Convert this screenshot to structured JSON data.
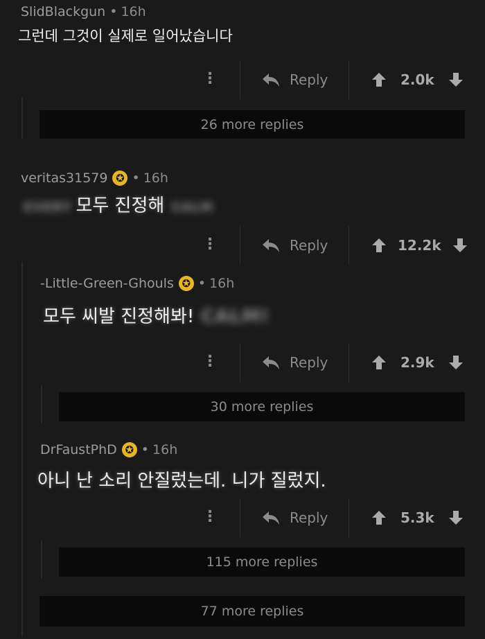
{
  "comments": [
    {
      "user": "SlidBlackgun",
      "time": "16h",
      "text": "그런데 그것이 실제로 일어났습니다",
      "reply_label": "Reply",
      "score": "2.0k"
    },
    {
      "user": "veritas31579",
      "time": "16h",
      "text": "모두 진정해",
      "blurred_suffix": "CALM",
      "reply_label": "Reply",
      "score": "12.2k"
    },
    {
      "user": "-Little-Green-Ghouls",
      "time": "16h",
      "text": "모두 씨발 진정해봐!",
      "blurred_suffix": "CALM!",
      "reply_label": "Reply",
      "score": "2.9k"
    },
    {
      "user": "DrFaustPhD",
      "time": "16h",
      "text": "아니 난 소리 안질렀는데. 니가 질렀지.",
      "reply_label": "Reply",
      "score": "5.3k"
    }
  ],
  "more_replies": [
    "26 more replies",
    "30 more replies",
    "115 more replies",
    "77 more replies"
  ],
  "colors": {
    "background": "#1a1a1b",
    "more_bar": "#0a0a0a",
    "award": "#e8b625"
  },
  "icons": {
    "more": "more-vertical-icon",
    "reply": "reply-arrow-icon",
    "upvote": "upvote-arrow-icon",
    "downvote": "downvote-arrow-icon",
    "award": "gold-award-icon"
  },
  "separator": "•"
}
